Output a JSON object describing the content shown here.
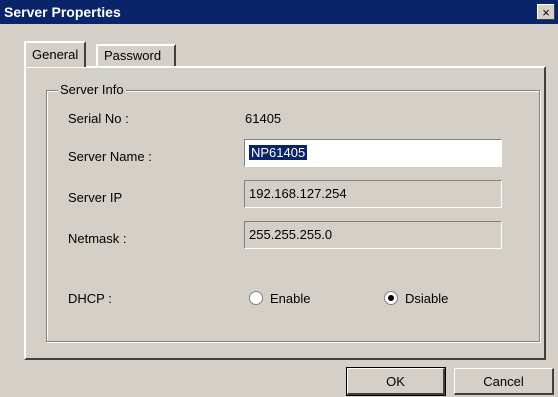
{
  "window": {
    "title": "Server Properties",
    "close_label": "×"
  },
  "tabs": [
    {
      "label": "General",
      "active": true
    },
    {
      "label": "Password",
      "active": false
    }
  ],
  "group": {
    "label": "Server Info"
  },
  "fields": {
    "serial": {
      "label": "Serial No :",
      "value": "61405"
    },
    "server_name": {
      "label": "Server Name :",
      "value": "NP61405"
    },
    "server_ip": {
      "label": "Server IP",
      "value": "192.168.127.254"
    },
    "netmask": {
      "label": "Netmask :",
      "value": "255.255.255.0"
    }
  },
  "dhcp": {
    "label": "DHCP :",
    "options": [
      {
        "label": "Enable",
        "selected": false
      },
      {
        "label": "Dsiable",
        "selected": true
      }
    ]
  },
  "buttons": {
    "ok": "OK",
    "cancel": "Cancel"
  },
  "colors": {
    "titlebar": "#0a246a",
    "face": "#d4d0c8",
    "selection": "#0a246a"
  }
}
